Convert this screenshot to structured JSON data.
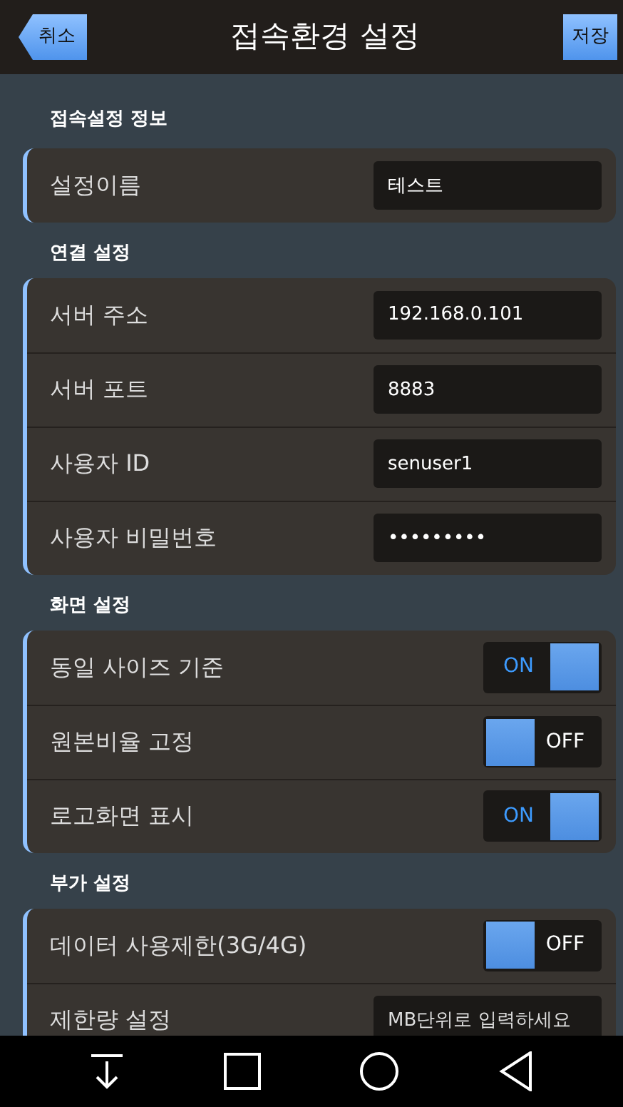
{
  "header": {
    "title": "접속환경 설정",
    "cancel": "취소",
    "save": "저장"
  },
  "sections": [
    {
      "title": "접속설정 정보",
      "rows": [
        {
          "kind": "text",
          "label": "설정이름",
          "value": "테스트"
        }
      ]
    },
    {
      "title": "연결 설정",
      "rows": [
        {
          "kind": "text",
          "label": "서버 주소",
          "value": "192.168.0.101"
        },
        {
          "kind": "text",
          "label": "서버 포트",
          "value": "8883"
        },
        {
          "kind": "text",
          "label": "사용자 ID",
          "value": "senuser1"
        },
        {
          "kind": "password",
          "label": "사용자 비밀번호",
          "value": "•••••••••"
        }
      ]
    },
    {
      "title": "화면 설정",
      "rows": [
        {
          "kind": "toggle",
          "label": "동일 사이즈 기준",
          "on": true,
          "text": "ON"
        },
        {
          "kind": "toggle",
          "label": "원본비율 고정",
          "on": false,
          "text": "OFF"
        },
        {
          "kind": "toggle",
          "label": "로고화면 표시",
          "on": true,
          "text": "ON"
        }
      ]
    },
    {
      "title": "부가 설정",
      "rows": [
        {
          "kind": "toggle",
          "label": "데이터 사용제한(3G/4G)",
          "on": false,
          "text": "OFF"
        },
        {
          "kind": "text",
          "label": "제한량 설정",
          "placeholder": "MB단위로 입력하세요"
        }
      ]
    }
  ]
}
